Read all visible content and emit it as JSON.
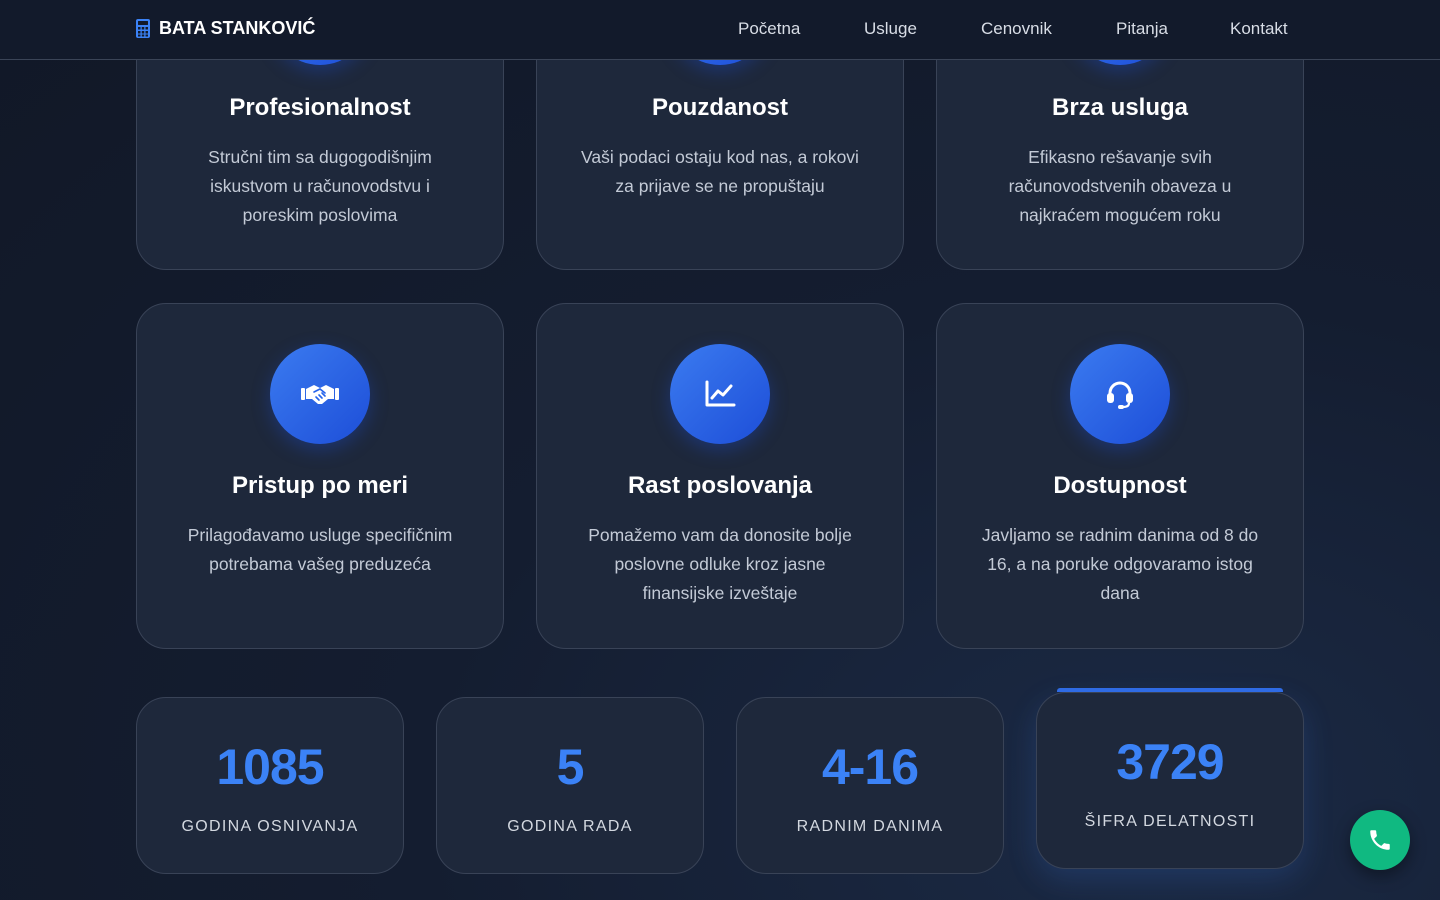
{
  "header": {
    "logo_text": "BATA STANKOVIĆ",
    "logo_icon": "calculator-icon",
    "nav": [
      {
        "label": "Početna"
      },
      {
        "label": "Usluge"
      },
      {
        "label": "Cenovnik"
      },
      {
        "label": "Pitanja"
      },
      {
        "label": "Kontakt"
      }
    ]
  },
  "features_top": [
    {
      "title": "Profesionalnost",
      "text": "Stručni tim sa dugogodišnjim iskustvom u računovodstvu i poreskim poslovima"
    },
    {
      "title": "Pouzdanost",
      "text": "Vaši podaci ostaju kod nas, a rokovi za prijave se ne propuštaju"
    },
    {
      "title": "Brza usluga",
      "text": "Efikasno rešavanje svih računovodstvenih obaveza u najkraćem mogućem roku"
    }
  ],
  "features_bottom": [
    {
      "title": "Pristup po meri",
      "text": "Prilagođavamo usluge specifičnim potrebama vašeg preduzeća",
      "icon": "handshake-icon"
    },
    {
      "title": "Rast poslovanja",
      "text": "Pomažemo vam da donosite bolje poslovne odluke kroz jasne finansijske izveštaje",
      "icon": "chart-line-icon"
    },
    {
      "title": "Dostupnost",
      "text": "Javljamo se radnim danima od 8 do 16, a na poruke odgovaramo istog dana",
      "icon": "headset-icon"
    }
  ],
  "stats": [
    {
      "value": "1085",
      "label": "GODINA OSNIVANJA"
    },
    {
      "value": "5",
      "label": "GODINA RADA"
    },
    {
      "value": "4-16",
      "label": "RADNIM DANIMA"
    },
    {
      "value": "3729",
      "label": "ŠIFRA DELATNOSTI"
    }
  ],
  "phone_button": {
    "icon": "phone-icon"
  },
  "colors": {
    "accent": "#3b82f6",
    "icon_circle": "#2563eb",
    "phone": "#10b981",
    "card_bg": "#1e283b",
    "page_bg": "#141d30"
  }
}
